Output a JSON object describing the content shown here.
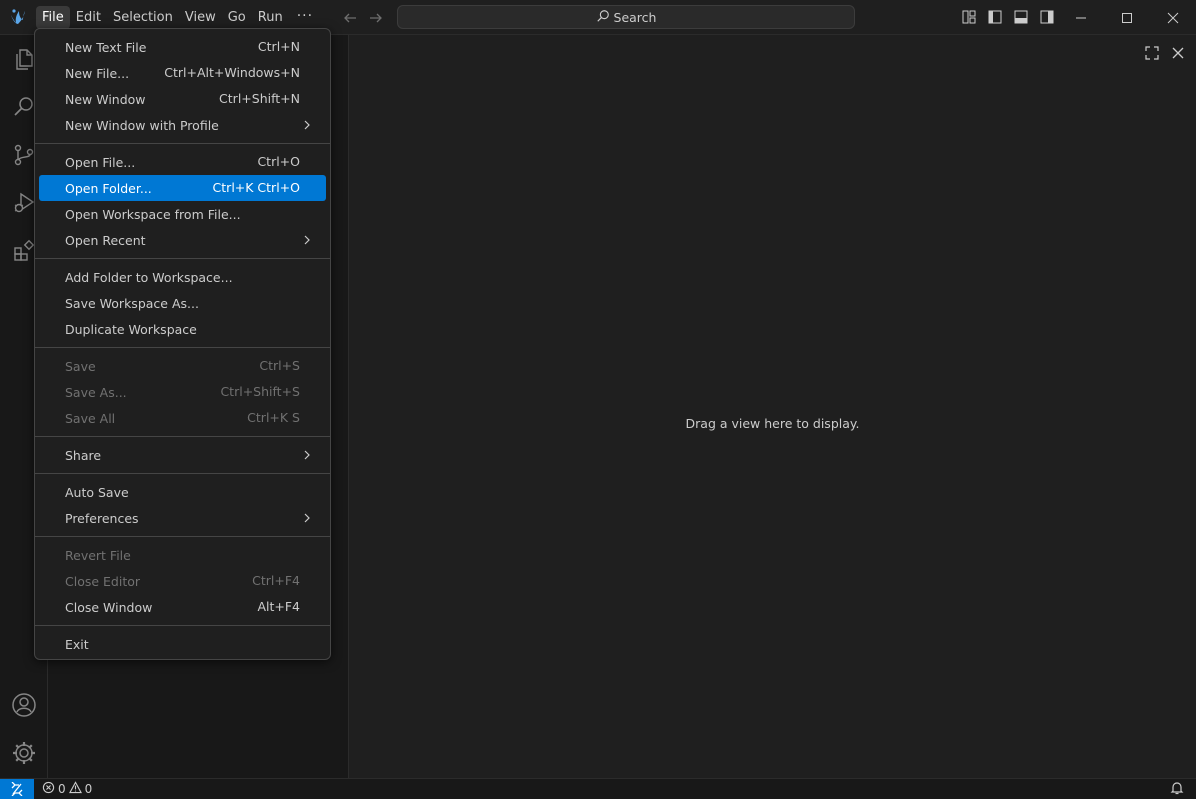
{
  "menubar": {
    "items": [
      "File",
      "Edit",
      "Selection",
      "View",
      "Go",
      "Run"
    ],
    "more": "···"
  },
  "search": {
    "label": "Search"
  },
  "editor": {
    "empty_message": "Drag a view here to display."
  },
  "file_menu": {
    "groups": [
      [
        {
          "label": "New Text File",
          "key": "Ctrl+N"
        },
        {
          "label": "New File...",
          "key": "Ctrl+Alt+Windows+N"
        },
        {
          "label": "New Window",
          "key": "Ctrl+Shift+N"
        },
        {
          "label": "New Window with Profile",
          "submenu": true
        }
      ],
      [
        {
          "label": "Open File...",
          "key": "Ctrl+O"
        },
        {
          "label": "Open Folder...",
          "key": "Ctrl+K Ctrl+O",
          "selected": true
        },
        {
          "label": "Open Workspace from File..."
        },
        {
          "label": "Open Recent",
          "submenu": true
        }
      ],
      [
        {
          "label": "Add Folder to Workspace..."
        },
        {
          "label": "Save Workspace As..."
        },
        {
          "label": "Duplicate Workspace"
        }
      ],
      [
        {
          "label": "Save",
          "key": "Ctrl+S",
          "disabled": true
        },
        {
          "label": "Save As...",
          "key": "Ctrl+Shift+S",
          "disabled": true
        },
        {
          "label": "Save All",
          "key": "Ctrl+K S",
          "disabled": true
        }
      ],
      [
        {
          "label": "Share",
          "submenu": true
        }
      ],
      [
        {
          "label": "Auto Save"
        },
        {
          "label": "Preferences",
          "submenu": true
        }
      ],
      [
        {
          "label": "Revert File",
          "disabled": true
        },
        {
          "label": "Close Editor",
          "key": "Ctrl+F4",
          "disabled": true
        },
        {
          "label": "Close Window",
          "key": "Alt+F4"
        }
      ],
      [
        {
          "label": "Exit"
        }
      ]
    ]
  },
  "statusbar": {
    "errors": "0",
    "warnings": "0"
  },
  "icons": {
    "logo": "vscodium-logo",
    "activity": [
      "explorer-icon",
      "search-icon",
      "source-control-icon",
      "run-debug-icon",
      "extensions-icon",
      "account-icon",
      "settings-gear-icon"
    ],
    "accent": "#0078d4"
  }
}
